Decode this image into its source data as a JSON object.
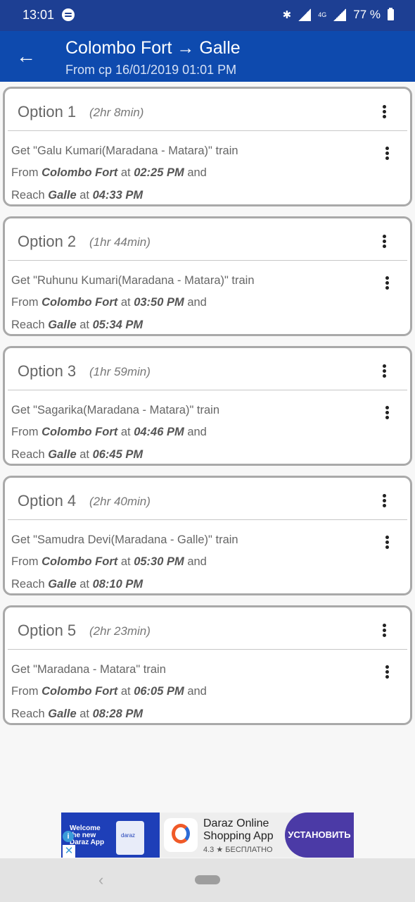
{
  "status": {
    "time": "13:01",
    "battery": "77 %",
    "network": "4G"
  },
  "header": {
    "title": "Colombo Fort → Galle",
    "subtitle": "From cp 16/01/2019  01:01 PM"
  },
  "options": [
    {
      "label": "Option 1",
      "duration": "(2hr 8min)",
      "train": "Get \"Galu Kumari(Maradana - Matara)\" train",
      "from_prefix": "From ",
      "from_station": "Colombo Fort",
      "at1": " at ",
      "depart": "02:25 PM",
      "and": " and",
      "reach_prefix": "Reach ",
      "to_station": "Galle",
      "at2": " at ",
      "arrive": "04:33 PM"
    },
    {
      "label": "Option 2",
      "duration": "(1hr 44min)",
      "train": "Get \"Ruhunu Kumari(Maradana - Matara)\" train",
      "from_prefix": "From ",
      "from_station": "Colombo Fort",
      "at1": " at ",
      "depart": "03:50 PM",
      "and": " and",
      "reach_prefix": "Reach ",
      "to_station": "Galle",
      "at2": " at ",
      "arrive": "05:34 PM"
    },
    {
      "label": "Option 3",
      "duration": "(1hr 59min)",
      "train": "Get \"Sagarika(Maradana - Matara)\" train",
      "from_prefix": "From ",
      "from_station": "Colombo Fort",
      "at1": " at ",
      "depart": "04:46 PM",
      "and": " and",
      "reach_prefix": "Reach ",
      "to_station": "Galle",
      "at2": " at ",
      "arrive": "06:45 PM"
    },
    {
      "label": "Option 4",
      "duration": "(2hr 40min)",
      "train": "Get \"Samudra Devi(Maradana - Galle)\" train",
      "from_prefix": "From ",
      "from_station": "Colombo Fort",
      "at1": " at ",
      "depart": "05:30 PM",
      "and": " and",
      "reach_prefix": "Reach ",
      "to_station": "Galle",
      "at2": " at ",
      "arrive": "08:10 PM"
    },
    {
      "label": "Option 5",
      "duration": "(2hr 23min)",
      "train": "Get \"Maradana - Matara\" train",
      "from_prefix": "From ",
      "from_station": "Colombo Fort",
      "at1": " at ",
      "depart": "06:05 PM",
      "and": " and",
      "reach_prefix": "Reach ",
      "to_station": "Galle",
      "at2": " at ",
      "arrive": "08:28 PM"
    }
  ],
  "ad": {
    "image_text": "Welcome the new Daraz App",
    "logo_text": "daraz",
    "app_name": "Daraz Online Shopping App",
    "rating": "4.3 ★ БЕСПЛАТНО",
    "install_label": "УСТАНОВИТЬ",
    "info_glyph": "i",
    "close_glyph": "✕"
  },
  "icons": {
    "back": "←",
    "nav_back": "‹"
  },
  "colors": {
    "status_bar": "#1d3f93",
    "app_bar": "#0e4aae",
    "ad_button": "#4b3aa6"
  }
}
